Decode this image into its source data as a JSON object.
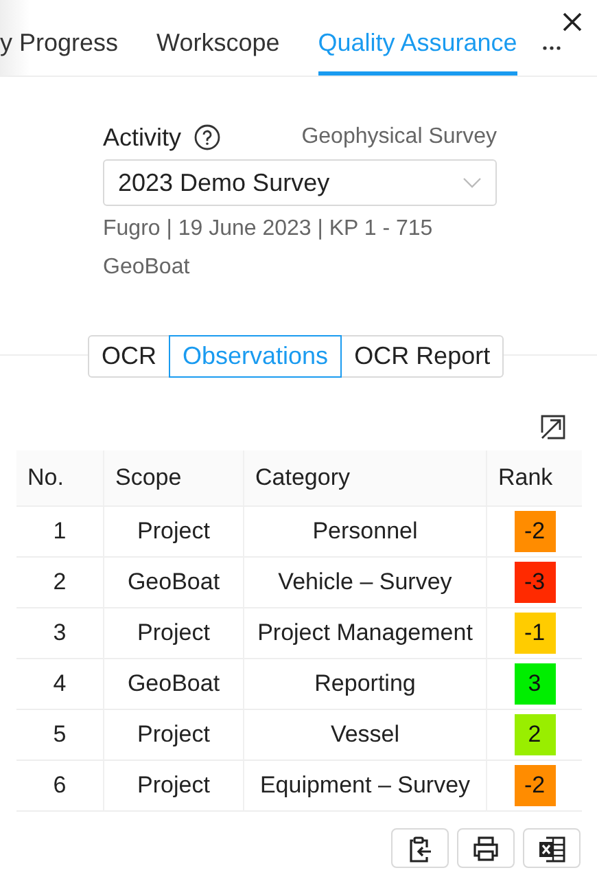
{
  "tabs": [
    {
      "label": "y Progress",
      "selected": false
    },
    {
      "label": "Workscope",
      "selected": false
    },
    {
      "label": "Quality Assurance",
      "selected": true
    }
  ],
  "activity": {
    "label": "Activity",
    "type": "Geophysical Survey",
    "value": "2023 Demo Survey",
    "details": [
      "Fugro | 19 June 2023 | KP 1 - 715",
      "GeoBoat"
    ]
  },
  "views": [
    {
      "label": "OCR",
      "selected": false
    },
    {
      "label": "Observations",
      "selected": true
    },
    {
      "label": "OCR Report",
      "selected": false
    }
  ],
  "table": {
    "columns": [
      "No.",
      "Scope",
      "Category",
      "Rank"
    ],
    "rows": [
      {
        "no": "1",
        "scope": "Project",
        "category": "Personnel",
        "rank": "-2",
        "color": "#ff8c00"
      },
      {
        "no": "2",
        "scope": "GeoBoat",
        "category": "Vehicle – Survey",
        "rank": "-3",
        "color": "#ff2a00"
      },
      {
        "no": "3",
        "scope": "Project",
        "category": "Project Management",
        "rank": "-1",
        "color": "#ffcc00"
      },
      {
        "no": "4",
        "scope": "GeoBoat",
        "category": "Reporting",
        "rank": "3",
        "color": "#00ee00"
      },
      {
        "no": "5",
        "scope": "Project",
        "category": "Vessel",
        "rank": "2",
        "color": "#99ee00"
      },
      {
        "no": "6",
        "scope": "Project",
        "category": "Equipment – Survey",
        "rank": "-2",
        "color": "#ff8c00"
      }
    ]
  },
  "actions": [
    {
      "kind": "copy"
    },
    {
      "kind": "print"
    },
    {
      "kind": "excel"
    }
  ]
}
